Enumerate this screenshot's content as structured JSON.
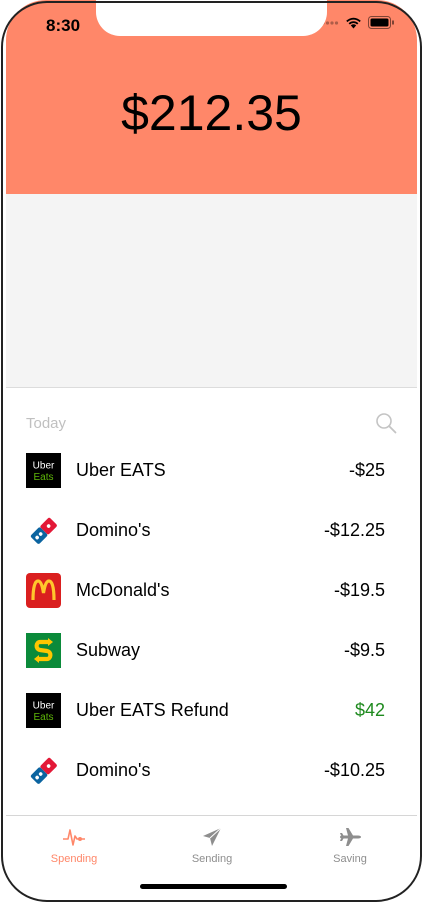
{
  "status_bar": {
    "time": "8:30"
  },
  "header": {
    "balance": "$212.35"
  },
  "colors": {
    "accent": "#ff8769",
    "positive": "#1e8a1e",
    "chart_bg": "#f4f4f4"
  },
  "list": {
    "section_title": "Today",
    "search_icon": "magnifier-icon",
    "transactions": [
      {
        "merchant": "Uber EATS",
        "amount": "-$25",
        "logo": "uber-eats-logo"
      },
      {
        "merchant": "Domino's",
        "amount": "-$12.25",
        "logo": "dominos-logo"
      },
      {
        "merchant": "McDonald's",
        "amount": "-$19.5",
        "logo": "mcdonalds-logo"
      },
      {
        "merchant": "Subway",
        "amount": "-$9.5",
        "logo": "subway-logo"
      },
      {
        "merchant": "Uber EATS Refund",
        "amount": "$42",
        "logo": "uber-eats-logo",
        "positive": true
      },
      {
        "merchant": "Domino's",
        "amount": "-$10.25",
        "logo": "dominos-logo"
      }
    ],
    "logo_text": {
      "uber_top": "Uber",
      "uber_bottom": "Eats"
    }
  },
  "tabs": [
    {
      "label": "Spending",
      "icon": "pulse-icon",
      "active": true
    },
    {
      "label": "Sending",
      "icon": "paper-plane-icon",
      "active": false
    },
    {
      "label": "Saving",
      "icon": "airplane-icon",
      "active": false
    }
  ]
}
